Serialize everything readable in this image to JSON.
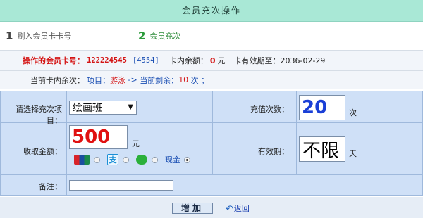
{
  "title": "会员充次操作",
  "steps": [
    {
      "num": "1",
      "label": "刷入会员卡卡号"
    },
    {
      "num": "2",
      "label": "会员充次"
    }
  ],
  "card_row": {
    "label": "操作的会员卡号：",
    "card_number": "122224545",
    "card_sub": "[4554]",
    "balance_label": "卡内余额：",
    "balance_value": "0",
    "balance_unit": "元",
    "expiry_label": "卡有效期至：",
    "expiry_value": "2036-02-29"
  },
  "count_row": {
    "label": "当前卡内余次：",
    "item_prefix": "项目：",
    "item_name": "游泳",
    "arrow": " -> ",
    "remain_label": "当前剩余：",
    "remain_value": "10",
    "remain_suffix": " 次 ；"
  },
  "form": {
    "project_label": "请选择充次项目：",
    "project_selected": "绘画班",
    "times_label": "充值次数：",
    "times_value": "20",
    "times_unit": "次",
    "amount_label": "收取金额：",
    "amount_value": "500",
    "amount_unit": "元",
    "validity_label": "有效期：",
    "validity_value": "不限",
    "validity_unit": "天",
    "payment_options": [
      {
        "icon": "unionpay-icon",
        "checked": false
      },
      {
        "icon": "alipay-icon",
        "checked": false
      },
      {
        "icon": "wechat-icon",
        "checked": false
      },
      {
        "label": "现金",
        "checked": true
      }
    ],
    "alipay_glyph": "支",
    "note_label": "备注：",
    "note_value": ""
  },
  "actions": {
    "add_label": "增加",
    "back_label": "返回"
  },
  "colors": {
    "title_bg": "#a9e8d6",
    "form_bg": "#cfe0f7",
    "accent_red": "#d41414",
    "accent_blue": "#1b4fb3",
    "step_green": "#2a9a3a"
  }
}
